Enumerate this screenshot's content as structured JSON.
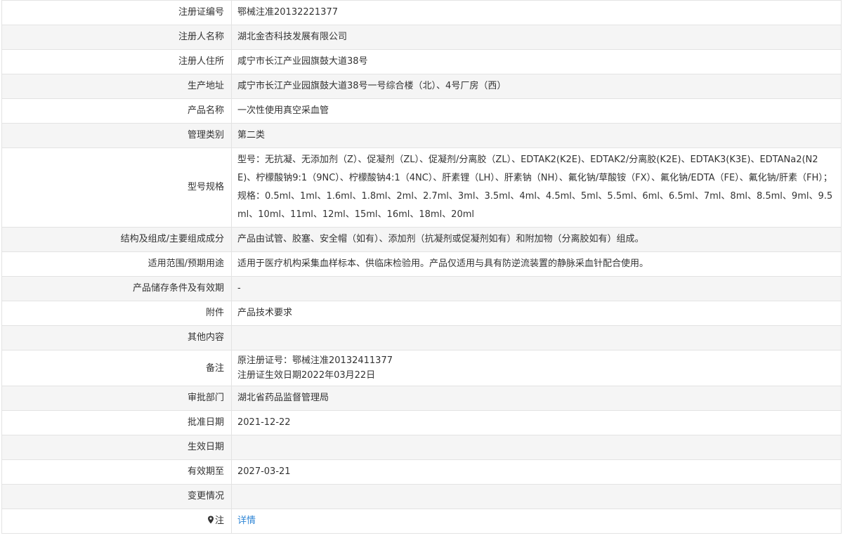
{
  "rows": [
    {
      "label": "注册证编号",
      "value": "鄂械注准20132221377"
    },
    {
      "label": "注册人名称",
      "value": "湖北金杏科技发展有限公司"
    },
    {
      "label": "注册人住所",
      "value": "咸宁市长江产业园旗鼓大道38号"
    },
    {
      "label": "生产地址",
      "value": "咸宁市长江产业园旗鼓大道38号一号综合楼（北）、4号厂房（西）"
    },
    {
      "label": "产品名称",
      "value": "一次性使用真空采血管"
    },
    {
      "label": "管理类别",
      "value": "第二类"
    },
    {
      "label": "型号规格",
      "value": "型号：无抗凝、无添加剂（Z）、促凝剂（ZL）、促凝剂/分离胶（ZL）、EDTAK2(K2E)、EDTAK2/分离胶(K2E)、EDTAK3(K3E)、EDTANa2(N2E)、柠檬酸钠9:1（9NC）、柠檬酸钠4:1（4NC）、肝素锂（LH）、肝素钠（NH）、氟化钠/草酸铵（FX）、氟化钠/EDTA（FE）、氟化钠/肝素（FH）；规格：0.5ml、1ml、1.6ml、1.8ml、2ml、2.7ml、3ml、3.5ml、4ml、4.5ml、5ml、5.5ml、6ml、6.5ml、7ml、8ml、8.5ml、9ml、9.5ml、10ml、11ml、12ml、15ml、16ml、18ml、20ml"
    },
    {
      "label": "结构及组成/主要组成成分",
      "value": "产品由试管、胶塞、安全帽（如有）、添加剂（抗凝剂或促凝剂如有）和附加物（分离胶如有）组成。"
    },
    {
      "label": "适用范围/预期用途",
      "value": "适用于医疗机构采集血样标本、供临床检验用。产品仅适用与具有防逆流装置的静脉采血针配合使用。"
    },
    {
      "label": "产品储存条件及有效期",
      "value": "-"
    },
    {
      "label": "附件",
      "value": "产品技术要求"
    },
    {
      "label": "其他内容",
      "value": ""
    },
    {
      "label": "备注",
      "value_line1": "原注册证号：鄂械注准20132411377",
      "value_line2": "注册证生效日期2022年03月22日"
    },
    {
      "label": "审批部门",
      "value": "湖北省药品监督管理局"
    },
    {
      "label": "批准日期",
      "value": "2021-12-22"
    },
    {
      "label": "生效日期",
      "value": ""
    },
    {
      "label": "有效期至",
      "value": "2027-03-21"
    },
    {
      "label": "变更情况",
      "value": ""
    },
    {
      "label": "注",
      "value": "详情"
    }
  ],
  "colors": {
    "border": "#e3e3e3",
    "stripe": "#f5f5f5",
    "link": "#2f86d6"
  },
  "icons": {
    "note": "map-pin-icon"
  }
}
